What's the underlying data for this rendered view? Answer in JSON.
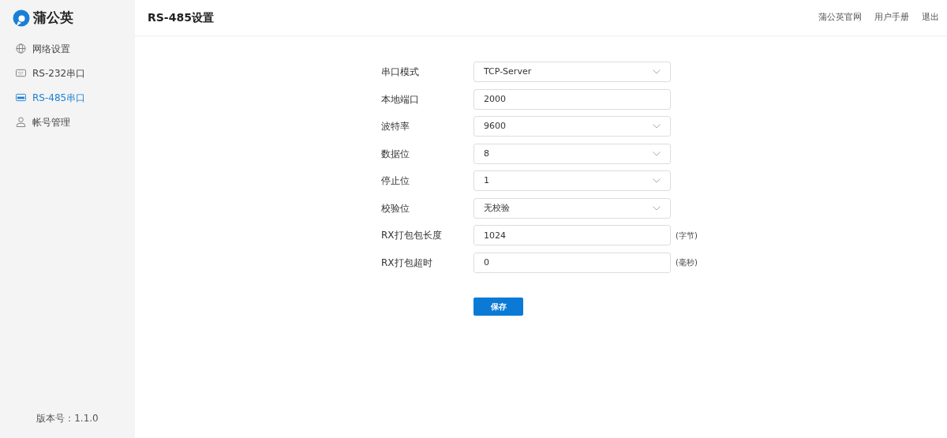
{
  "logo": {
    "text": "蒲公英"
  },
  "sidebar": {
    "items": [
      {
        "label": "网络设置",
        "kind": "globe",
        "selected": false
      },
      {
        "label": "RS-232串口",
        "kind": "port",
        "selected": false
      },
      {
        "label": "RS-485串口",
        "kind": "port",
        "selected": true
      },
      {
        "label": "帐号管理",
        "kind": "user",
        "selected": false
      }
    ],
    "version": "版本号：1.1.0"
  },
  "header": {
    "title": "RS-485设置",
    "links": [
      "蒲公英官网",
      "用户手册",
      "退出"
    ]
  },
  "form": {
    "fields": [
      {
        "label": "串口模式",
        "kind": "select",
        "value": "TCP-Server"
      },
      {
        "label": "本地端口",
        "kind": "input",
        "value": "2000"
      },
      {
        "label": "波特率",
        "kind": "select",
        "value": "9600"
      },
      {
        "label": "数据位",
        "kind": "select",
        "value": "8"
      },
      {
        "label": "停止位",
        "kind": "select",
        "value": "1"
      },
      {
        "label": "校验位",
        "kind": "select",
        "value": "无校验"
      },
      {
        "label": "RX打包包长度",
        "kind": "input",
        "value": "1024",
        "unit": "(字节)"
      },
      {
        "label": "RX打包超时",
        "kind": "input",
        "value": "0",
        "unit": "(毫秒)"
      }
    ],
    "save_button": "保存"
  }
}
